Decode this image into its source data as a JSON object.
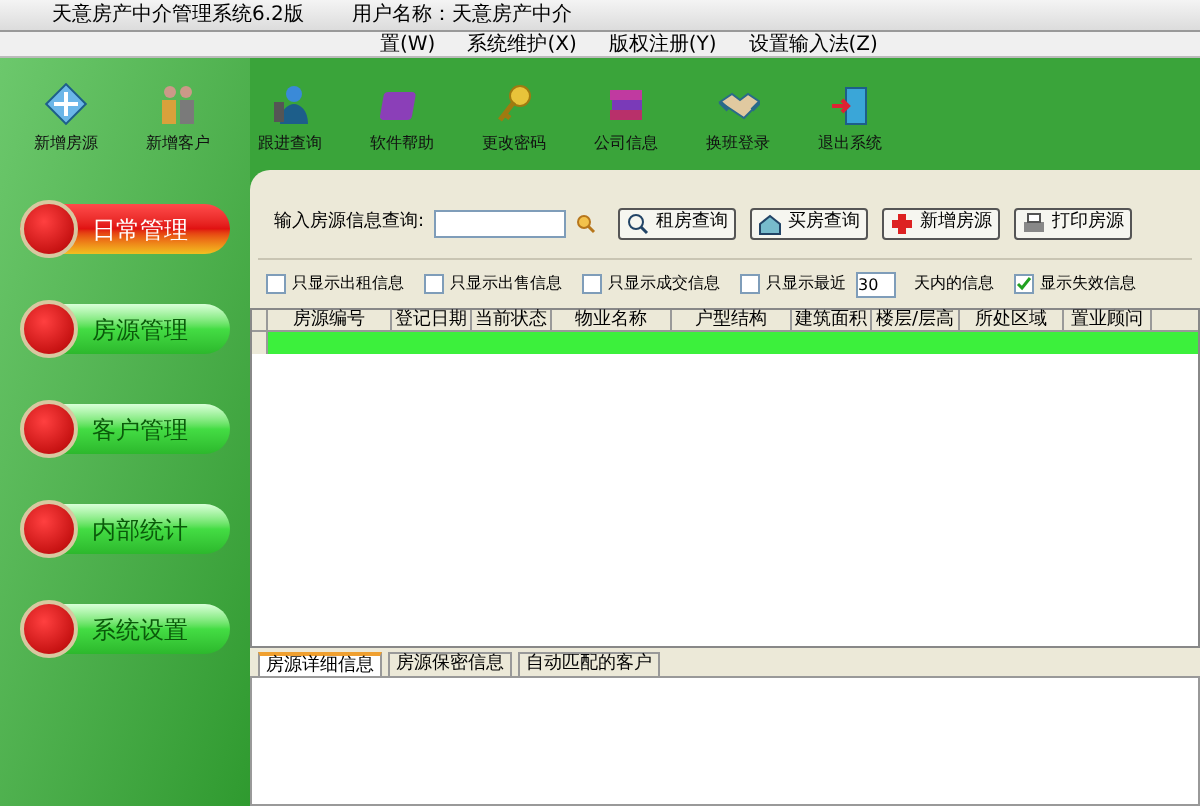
{
  "window": {
    "title": "天意房产中介管理系统6.2版",
    "user": "用户名称：天意房产中介"
  },
  "menu": [
    "置(W)",
    "系统维护(X)",
    "版权注册(Y)",
    "设置输入法(Z)"
  ],
  "toolbar": [
    {
      "label": "新增房源",
      "kind": "house"
    },
    {
      "label": "新增客户",
      "kind": "people"
    },
    {
      "label": "跟进查询",
      "kind": "person"
    },
    {
      "label": "软件帮助",
      "kind": "book"
    },
    {
      "label": "更改密码",
      "kind": "key"
    },
    {
      "label": "公司信息",
      "kind": "books"
    },
    {
      "label": "换班登录",
      "kind": "handshake"
    },
    {
      "label": "退出系统",
      "kind": "door"
    }
  ],
  "sidebar": [
    {
      "label": "日常管理",
      "selected": true
    },
    {
      "label": "房源管理",
      "selected": false
    },
    {
      "label": "客户管理",
      "selected": false
    },
    {
      "label": "内部统计",
      "selected": false
    },
    {
      "label": "系统设置",
      "selected": false
    }
  ],
  "search": {
    "label": "输入房源信息查询:",
    "buttons": [
      "租房查询",
      "买房查询",
      "新增房源",
      "打印房源"
    ]
  },
  "filters": [
    {
      "label": "只显示出租信息",
      "checked": false
    },
    {
      "label": "只显示出售信息",
      "checked": false
    },
    {
      "label": "只显示成交信息",
      "checked": false
    },
    {
      "label": "只显示最近",
      "checked": false,
      "days": "30",
      "suffix": "天内的信息"
    },
    {
      "label": "显示失效信息",
      "checked": true
    }
  ],
  "table": {
    "columns": [
      "房源编号",
      "登记日期",
      "当前状态",
      "物业名称",
      "户型结构",
      "建筑面积",
      "楼层/层高",
      "所处区域",
      "置业顾问"
    ]
  },
  "tabs": [
    {
      "label": "房源详细信息",
      "selected": true
    },
    {
      "label": "房源保密信息",
      "selected": false
    },
    {
      "label": "自动匹配的客户",
      "selected": false
    }
  ]
}
